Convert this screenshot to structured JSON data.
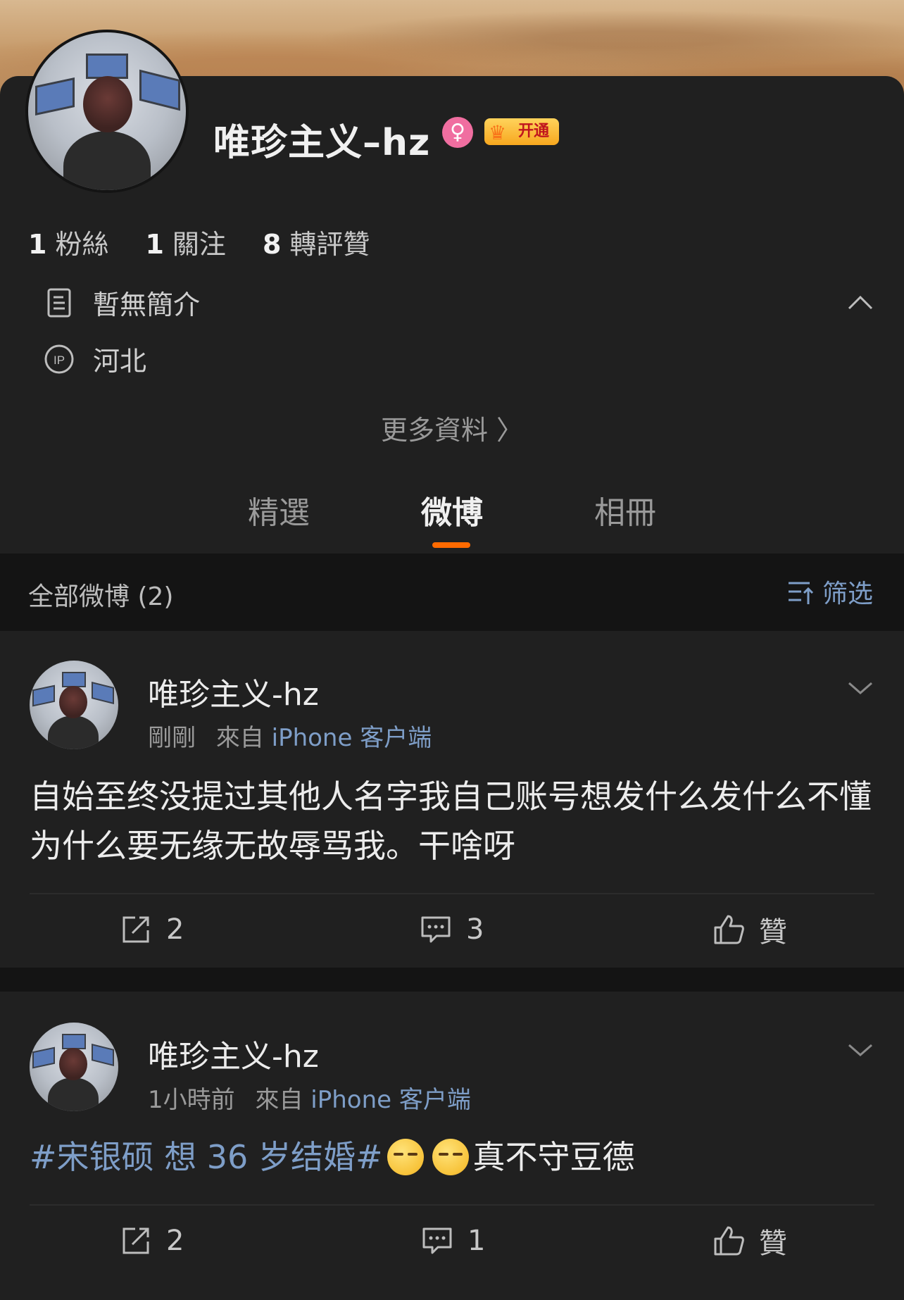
{
  "profile": {
    "name": "唯珍主义–hz",
    "gender_symbol": "♀",
    "vip_label": "开通",
    "stats": [
      {
        "num": "1",
        "label": "粉絲"
      },
      {
        "num": "1",
        "label": "關注"
      },
      {
        "num": "8",
        "label": "轉評贊"
      }
    ],
    "bio": "暫無簡介",
    "ip_location": "河北",
    "more_info": "更多資料 〉"
  },
  "tabs": [
    "精選",
    "微博",
    "相冊"
  ],
  "active_tab": "微博",
  "filter": {
    "count_label": "全部微博 (2)",
    "button_label": "筛选"
  },
  "posts": [
    {
      "author": "唯珍主义-hz",
      "time": "剛剛",
      "source_prefix": "來自",
      "source": "iPhone 客户端",
      "text": "自始至终没提过其他人名字我自己账号想发什么发什么不懂为什么要无缘无故辱骂我。干啥呀",
      "repost_count": "2",
      "comment_count": "3",
      "like_label": "贊"
    },
    {
      "author": "唯珍主义-hz",
      "time": "1小時前",
      "source_prefix": "來自",
      "source": "iPhone 客户端",
      "hashtag": "#宋银硕 想 36 岁结婚#",
      "text_after": "真不守豆德",
      "emoji_name": "smirk-emoji",
      "repost_count": "2",
      "comment_count": "1",
      "like_label": "贊"
    }
  ],
  "colors": {
    "background": "#141414",
    "card": "#202020",
    "accent_orange": "#ff6a00",
    "link_blue": "#7e9ec8",
    "gender_pink": "#f06ea0",
    "vip_gold": "#f7a71f"
  }
}
